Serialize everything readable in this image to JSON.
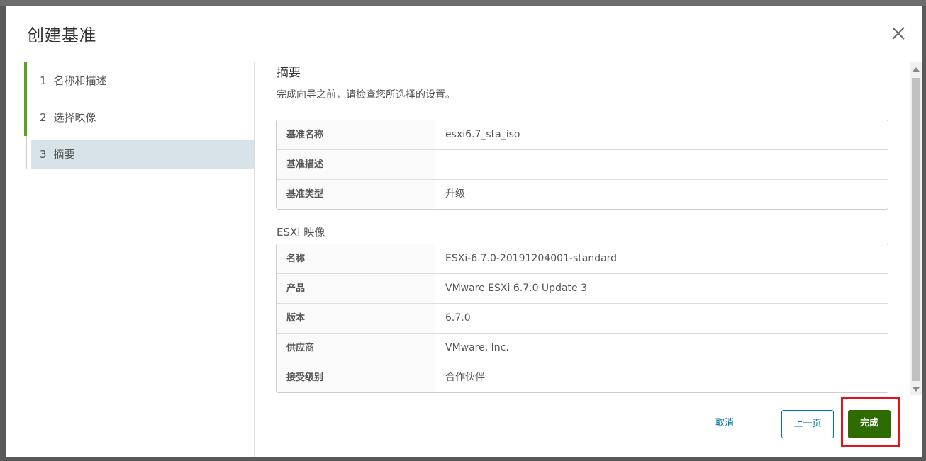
{
  "dialog": {
    "title": "创建基准",
    "close_icon": "close-icon"
  },
  "steps": [
    {
      "num": "1",
      "label": "名称和描述"
    },
    {
      "num": "2",
      "label": "选择映像"
    },
    {
      "num": "3",
      "label": "摘要"
    }
  ],
  "summary": {
    "title": "摘要",
    "description": "完成向导之前，请检查您所选择的设置。",
    "baseline_rows": [
      {
        "key": "基准名称",
        "value": "esxi6.7_sta_iso"
      },
      {
        "key": "基准描述",
        "value": ""
      },
      {
        "key": "基准类型",
        "value": "升级"
      }
    ],
    "image_title": "ESXi 映像",
    "image_rows": [
      {
        "key": "名称",
        "value": "ESXi-6.7.0-20191204001-standard"
      },
      {
        "key": "产品",
        "value": "VMware ESXi 6.7.0 Update 3"
      },
      {
        "key": "版本",
        "value": "6.7.0"
      },
      {
        "key": "供应商",
        "value": "VMware, Inc."
      },
      {
        "key": "接受级别",
        "value": "合作伙伴"
      }
    ]
  },
  "footer": {
    "cancel_label": "取消",
    "back_label": "上一页",
    "finish_label": "完成"
  },
  "colors": {
    "accent": "#0072a3",
    "finish": "#2f6c00",
    "step_done": "#5aa220",
    "highlight": "#e1141c"
  }
}
